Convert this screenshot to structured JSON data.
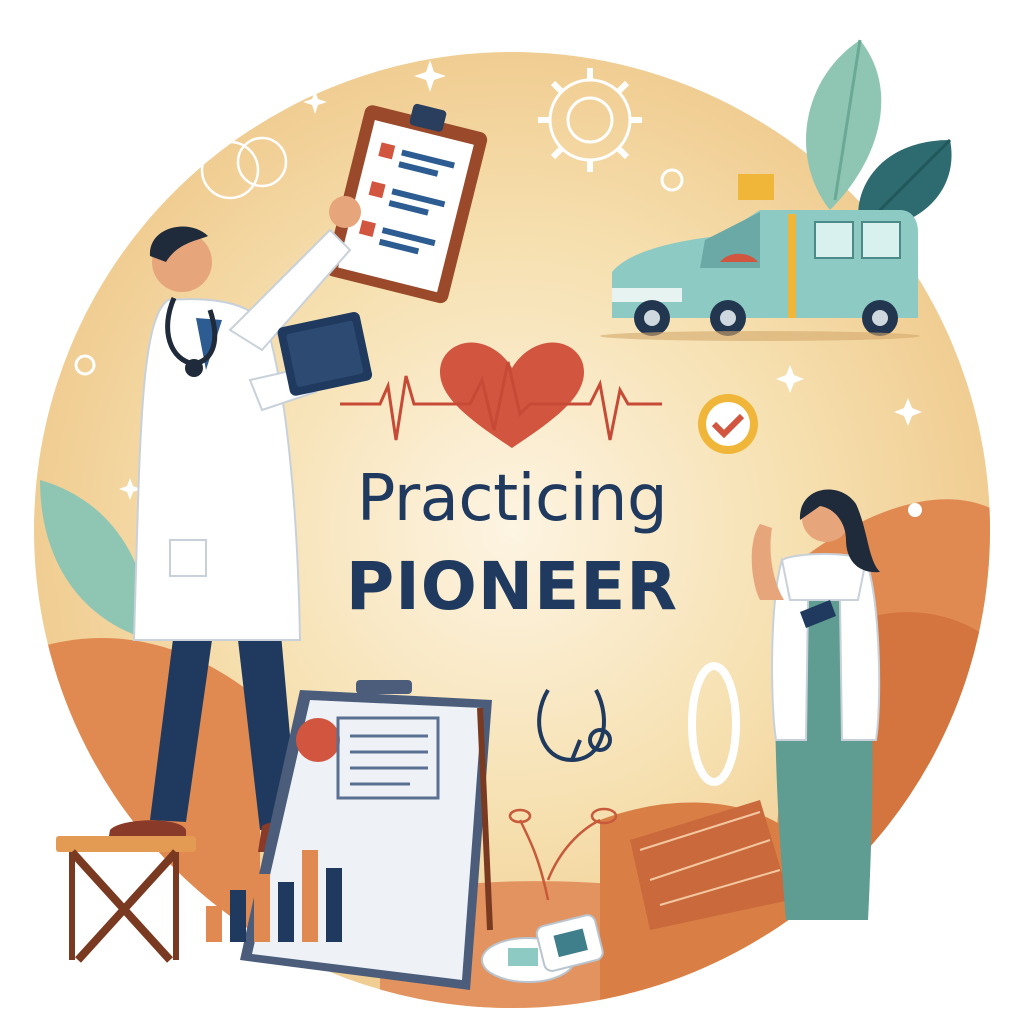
{
  "title": {
    "line1": "Practicing",
    "line2": "PIONEER"
  },
  "colors": {
    "navy": "#1f3a5e",
    "background_warm": "#f3d49a",
    "background_center": "#fbf1da",
    "heart_red": "#d2553f",
    "teal": "#7fbfb6",
    "orange": "#e08a52",
    "dark_teal_leaf": "#2e6b70"
  },
  "icons": [
    "heart-pulse-icon",
    "gear-icon",
    "stethoscope-icon",
    "clipboard-icon",
    "tablet-icon",
    "ambulance-icon",
    "check-badge-icon",
    "bar-chart-icon",
    "pill-box-icon",
    "sparkle-icon"
  ]
}
